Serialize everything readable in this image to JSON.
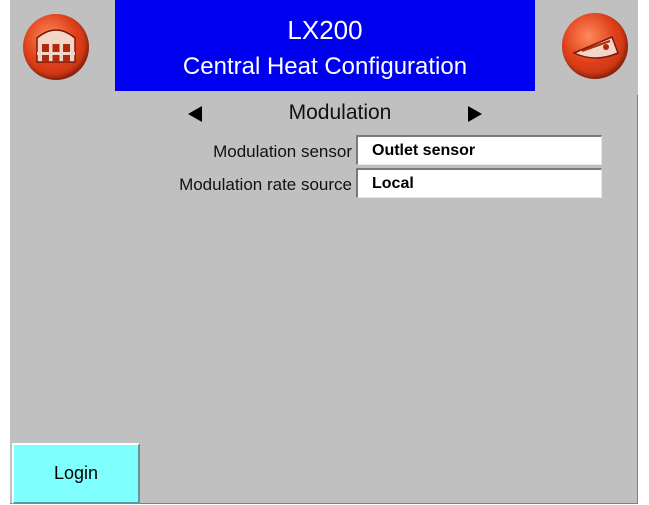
{
  "header": {
    "title": "LX200",
    "subtitle": "Central Heat Configuration",
    "home_icon": "building-icon",
    "exit_icon": "exit-icon"
  },
  "section": {
    "title": "Modulation",
    "prev_icon": "triangle-left-icon",
    "next_icon": "triangle-right-icon"
  },
  "fields": [
    {
      "label": "Modulation sensor",
      "value": "Outlet sensor"
    },
    {
      "label": "Modulation rate source",
      "value": "Local"
    }
  ],
  "footer": {
    "login_label": "Login"
  },
  "colors": {
    "title_bg": "#0000f0",
    "screen_bg": "#c0c0c0",
    "button_red": "#e0401a",
    "login_bg": "#80ffff"
  }
}
